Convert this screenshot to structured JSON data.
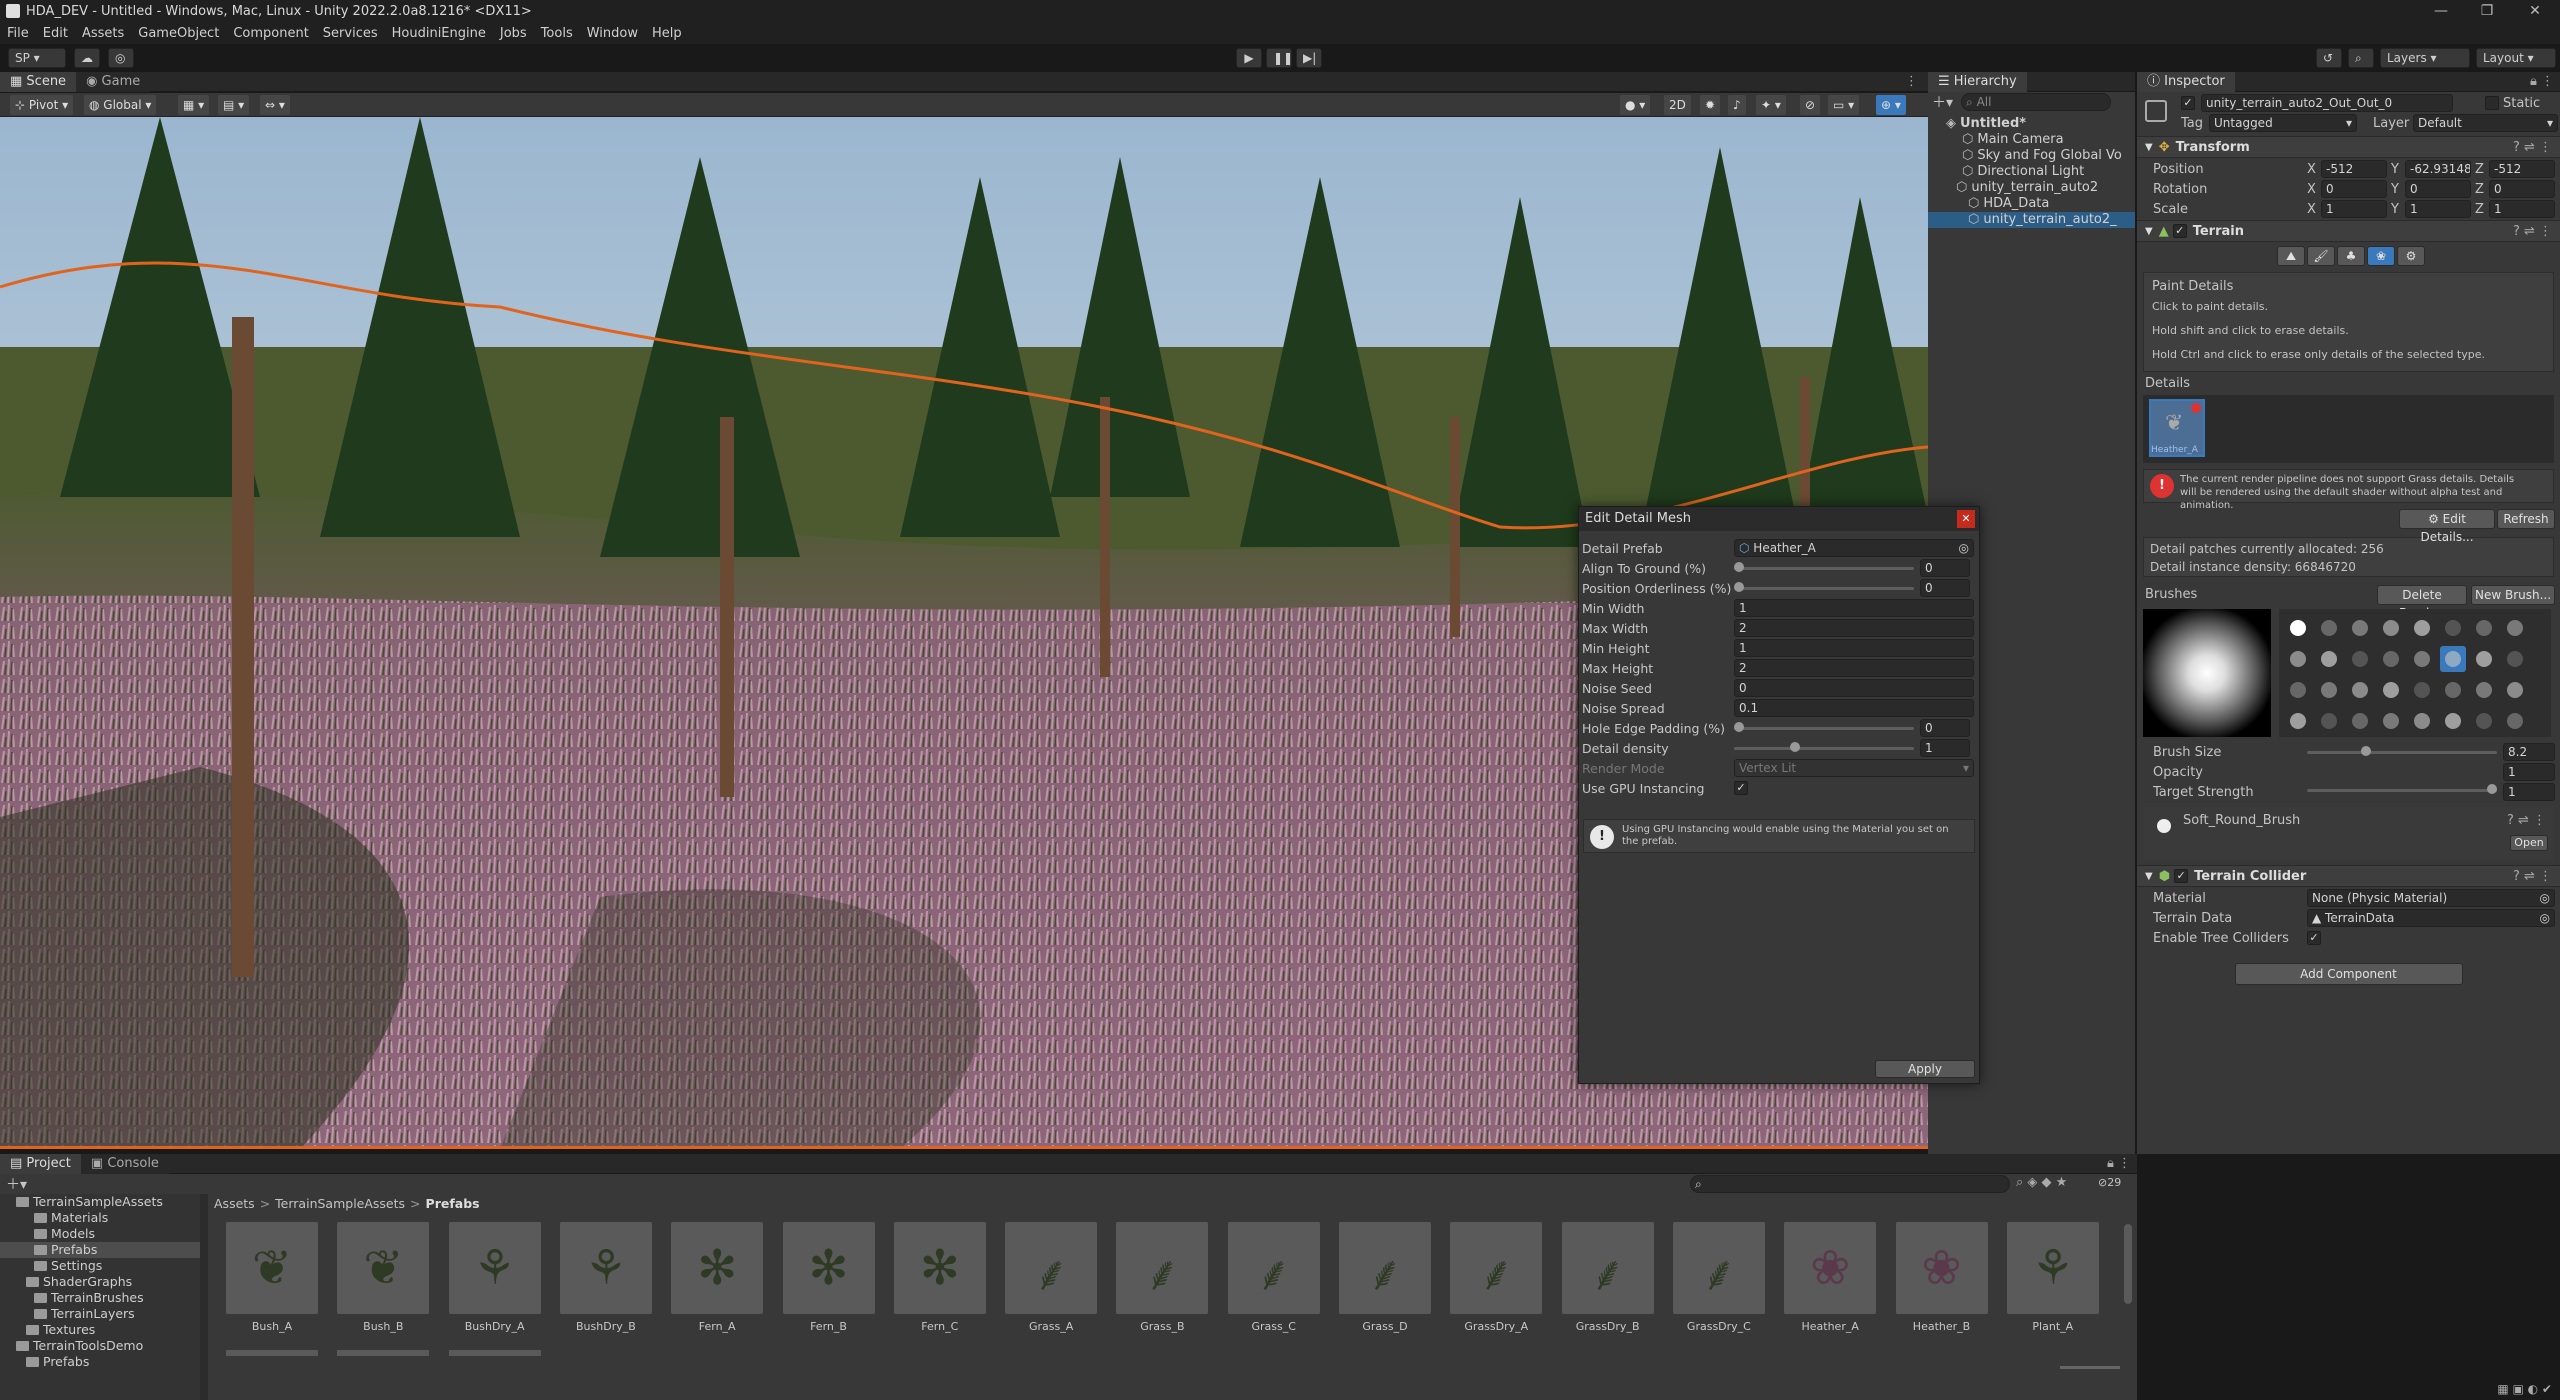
{
  "titlebar": {
    "title": "HDA_DEV - Untitled - Windows, Mac, Linux - Unity 2022.2.0a8.1216* <DX11>"
  },
  "menu": [
    "File",
    "Edit",
    "Assets",
    "GameObject",
    "Component",
    "Services",
    "HoudiniEngine",
    "Jobs",
    "Tools",
    "Window",
    "Help"
  ],
  "toolbar": {
    "account": "SP",
    "layers": "Layers",
    "layout": "Layout"
  },
  "scene": {
    "tabs": [
      "Scene",
      "Game"
    ],
    "pivot": "Pivot",
    "global": "Global",
    "mode_2d": "2D"
  },
  "hierarchy": {
    "title": "Hierarchy",
    "search_placeholder": "All",
    "items": [
      "Untitled*",
      "Main Camera",
      "Sky and Fog Global Vo",
      "Directional Light",
      "unity_terrain_auto2",
      "HDA_Data",
      "unity_terrain_auto2_"
    ]
  },
  "inspector": {
    "title": "Inspector",
    "object_name": "unity_terrain_auto2_Out_Out_0",
    "static_label": "Static",
    "tag_label": "Tag",
    "tag_value": "Untagged",
    "layer_label": "Layer",
    "layer_value": "Default",
    "transform": {
      "title": "Transform",
      "position_label": "Position",
      "rotation_label": "Rotation",
      "scale_label": "Scale",
      "axis": [
        "X",
        "Y",
        "Z"
      ],
      "position": [
        "-512",
        "-62.93148",
        "-512"
      ],
      "rotation": [
        "0",
        "0",
        "0"
      ],
      "scale": [
        "1",
        "1",
        "1"
      ]
    },
    "terrain": {
      "title": "Terrain",
      "paint_details_title": "Paint Details",
      "hint1": "Click to paint details.",
      "hint2": "Hold shift and click to erase details.",
      "hint3": "Hold Ctrl and click to erase only details of the selected type.",
      "details_label": "Details",
      "detail_name": "Heather_A",
      "warning": "The current render pipeline does not support Grass details. Details will be rendered using the default shader without alpha test and animation.",
      "edit_details": "Edit Details...",
      "refresh": "Refresh",
      "patches": "Detail patches currently allocated: 256",
      "density": "Detail instance density: 66846720",
      "brushes_label": "Brushes",
      "delete_brush": "Delete Brush...",
      "new_brush": "New Brush...",
      "brush_size_label": "Brush Size",
      "brush_size": "8.2",
      "brush_size_frac": 0.3,
      "opacity_label": "Opacity",
      "opacity": "1",
      "target_strength_label": "Target Strength",
      "target_strength": "1",
      "brush_name": "Soft_Round_Brush",
      "open": "Open"
    },
    "collider": {
      "title": "Terrain Collider",
      "material_label": "Material",
      "material_value": "None (Physic Material)",
      "terrain_data_label": "Terrain Data",
      "terrain_data_value": "TerrainData",
      "enable_trees_label": "Enable Tree Colliders"
    },
    "add_component": "Add Component"
  },
  "dialog": {
    "title": "Edit Detail Mesh",
    "detail_prefab_label": "Detail Prefab",
    "detail_prefab_value": "Heather_A",
    "align_label": "Align To Ground (%)",
    "align_value": "0",
    "position_orderliness_label": "Position Orderliness (%)",
    "position_orderliness_value": "0",
    "min_width_label": "Min Width",
    "min_width": "1",
    "max_width_label": "Max Width",
    "max_width": "2",
    "min_height_label": "Min Height",
    "min_height": "1",
    "max_height_label": "Max Height",
    "max_height": "2",
    "noise_seed_label": "Noise Seed",
    "noise_seed": "0",
    "noise_spread_label": "Noise Spread",
    "noise_spread": "0.1",
    "hole_edge_label": "Hole Edge Padding (%)",
    "hole_edge_value": "0",
    "detail_density_label": "Detail density",
    "detail_density_value": "1",
    "detail_density_frac": 0.33,
    "render_mode_label": "Render Mode",
    "render_mode_value": "Vertex Lit",
    "gpu_label": "Use GPU Instancing",
    "gpu_info": "Using GPU Instancing would enable using the Material you set on the prefab.",
    "apply": "Apply"
  },
  "project": {
    "tabs": [
      "Project",
      "Console"
    ],
    "breadcrumb": [
      "Assets",
      "TerrainSampleAssets",
      "Prefabs"
    ],
    "count": "29",
    "tree": [
      "TerrainSampleAssets",
      "Materials",
      "Models",
      "Prefabs",
      "Settings",
      "ShaderGraphs",
      "TerrainBrushes",
      "TerrainLayers",
      "Textures",
      "TerrainToolsDemo",
      "Prefabs"
    ],
    "assets": [
      "Bush_A",
      "Bush_B",
      "BushDry_A",
      "BushDry_B",
      "Fern_A",
      "Fern_B",
      "Fern_C",
      "Grass_A",
      "Grass_B",
      "Grass_C",
      "Grass_D",
      "GrassDry_A",
      "GrassDry_B",
      "GrassDry_C",
      "Heather_A",
      "Heather_B",
      "Plant_A"
    ]
  },
  "colors": {
    "accent": "#3a79bb",
    "selection": "#2c5d87",
    "terrain_outline": "#e0641e"
  }
}
